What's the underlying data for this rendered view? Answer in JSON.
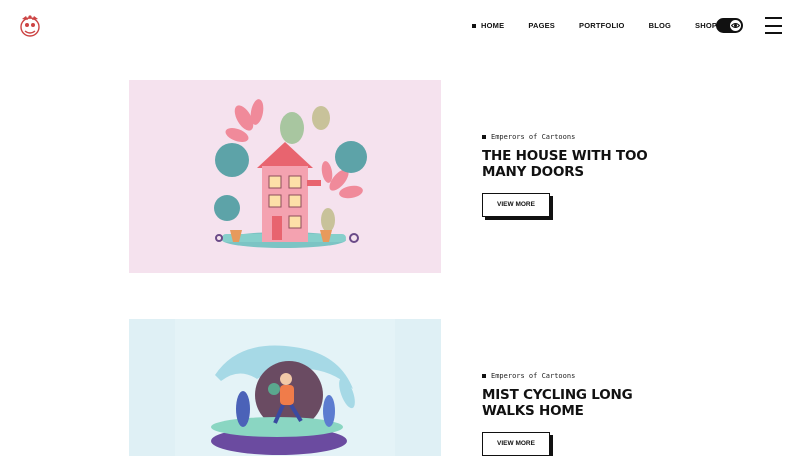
{
  "header": {
    "nav": {
      "home": "HOME",
      "pages": "PAGES",
      "portfolio": "PORTFOLIO",
      "blog": "BLOG",
      "shop": "SHOP"
    },
    "icons": {
      "logo": "cartoon-logo-icon",
      "toggle": "eye-toggle-icon",
      "menu": "hamburger-menu-icon"
    }
  },
  "projects": [
    {
      "category": "Emperors of Cartoons",
      "title": "THE HOUSE WITH TOO MANY DOORS",
      "button": "VIEW MORE",
      "image_bg": "#f5e2ee"
    },
    {
      "category": "Emperors of Cartoons",
      "title": "MIST CYCLING LONG WALKS HOME",
      "button": "VIEW MORE",
      "image_bg": "#dff0f5"
    }
  ]
}
